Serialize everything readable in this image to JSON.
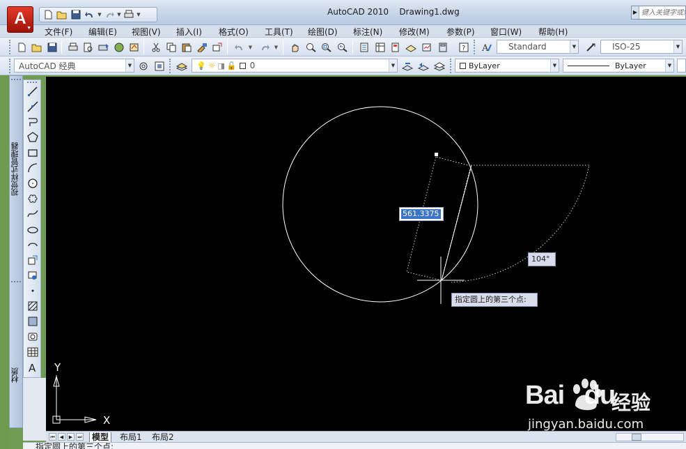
{
  "titlebar": {
    "app_name": "AutoCAD 2010",
    "document": "Drawing1.dwg",
    "search_placeholder": "键入关键字或短语"
  },
  "menu": [
    "文件(F)",
    "编辑(E)",
    "视图(V)",
    "插入(I)",
    "格式(O)",
    "工具(T)",
    "绘图(D)",
    "标注(N)",
    "修改(M)",
    "参数(P)",
    "窗口(W)",
    "帮助(H)"
  ],
  "toolbar1": {
    "text_style": "Standard",
    "dim_style": "ISO-25"
  },
  "toolbar2": {
    "workspace": "AutoCAD 经典",
    "layer": "0",
    "color": "ByLayer",
    "linetype": "ByLayer"
  },
  "palettes": {
    "top_title": "视觉样式管理器",
    "bottom_title": "材质"
  },
  "canvas": {
    "dynamic_input_value": "561.3375",
    "angle_value": "104°",
    "prompt_tooltip": "指定圆上的第三个点:",
    "ucs_x": "X",
    "ucs_y": "Y"
  },
  "layout_tabs": [
    "模型",
    "布局1",
    "布局2"
  ],
  "command_line": "指定圆上的第三个点:",
  "watermark": {
    "brand": "Baidu",
    "product": "经验",
    "url": "jingyan.baidu.com"
  },
  "colors": {
    "canvas_bg": "#000000",
    "entity": "#ffffff",
    "selection_blue": "#3a74c9",
    "logo_red": "#c8261a"
  }
}
